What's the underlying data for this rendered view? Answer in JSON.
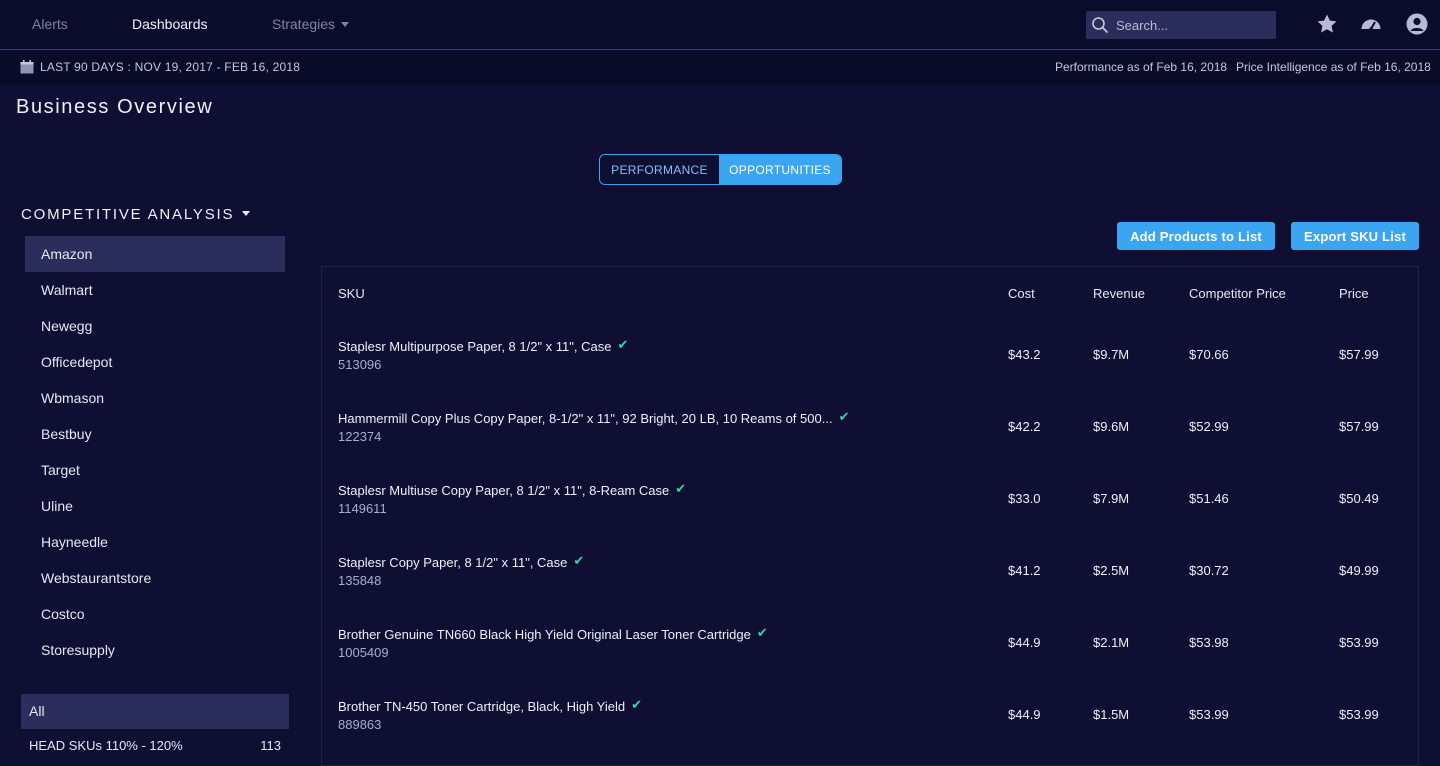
{
  "nav": {
    "items": [
      "Alerts",
      "Dashboards",
      "Strategies"
    ],
    "search_placeholder": "Search..."
  },
  "datebar": {
    "range": "LAST 90 DAYS : NOV 19, 2017 - FEB 16, 2018",
    "performance_asof": "Performance as of Feb 16, 2018",
    "price_asof": "Price Intelligence as of Feb 16, 2018"
  },
  "page": {
    "title": "Business Overview"
  },
  "toggle": {
    "left": "PERFORMANCE",
    "right": "OPPORTUNITIES"
  },
  "competitive": {
    "title": "COMPETITIVE ANALYSIS",
    "items": [
      "Amazon",
      "Walmart",
      "Newegg",
      "Officedepot",
      "Wbmason",
      "Bestbuy",
      "Target",
      "Uline",
      "Hayneedle",
      "Webstaurantstore",
      "Costco",
      "Storesupply"
    ]
  },
  "filters": {
    "all": "All",
    "head_label": "HEAD SKUs 110% - 120%",
    "head_count": "113"
  },
  "actions": {
    "add": "Add Products to List",
    "export": "Export SKU List"
  },
  "table": {
    "headers": {
      "sku": "SKU",
      "cost": "Cost",
      "revenue": "Revenue",
      "competitor": "Competitor Price",
      "price": "Price"
    },
    "check": "✔",
    "rows": [
      {
        "name": "Staplesr Multipurpose Paper, 8 1/2\" x 11\", Case",
        "sku": "513096",
        "cost": "$43.2",
        "revenue": "$9.7M",
        "competitor": "$70.66",
        "price": "$57.99"
      },
      {
        "name": "Hammermill Copy Plus Copy Paper, 8-1/2\" x 11\", 92 Bright, 20 LB, 10 Reams of 500...",
        "sku": "122374",
        "cost": "$42.2",
        "revenue": "$9.6M",
        "competitor": "$52.99",
        "price": "$57.99"
      },
      {
        "name": "Staplesr Multiuse Copy Paper, 8 1/2\" x 11\", 8-Ream Case",
        "sku": "1149611",
        "cost": "$33.0",
        "revenue": "$7.9M",
        "competitor": "$51.46",
        "price": "$50.49"
      },
      {
        "name": "Staplesr Copy Paper, 8 1/2\" x 11\", Case",
        "sku": "135848",
        "cost": "$41.2",
        "revenue": "$2.5M",
        "competitor": "$30.72",
        "price": "$49.99"
      },
      {
        "name": "Brother Genuine TN660 Black High Yield Original Laser Toner Cartridge",
        "sku": "1005409",
        "cost": "$44.9",
        "revenue": "$2.1M",
        "competitor": "$53.98",
        "price": "$53.99"
      },
      {
        "name": "Brother TN-450 Toner Cartridge, Black, High Yield",
        "sku": "889863",
        "cost": "$44.9",
        "revenue": "$1.5M",
        "competitor": "$53.99",
        "price": "$53.99"
      }
    ]
  }
}
